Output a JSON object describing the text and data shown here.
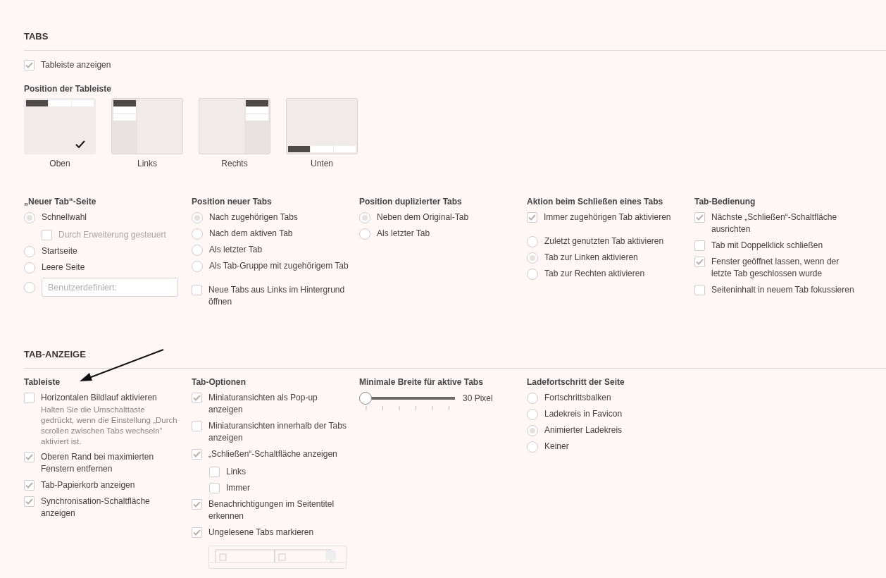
{
  "sections": [
    {
      "heading": "TABS",
      "show_tabbar": {
        "label": "Tableiste anzeigen",
        "checked": true
      },
      "positions_title": "Position der Tableiste",
      "positions": [
        {
          "kind": "top",
          "label": "Oben",
          "selected": true
        },
        {
          "kind": "left",
          "label": "Links",
          "selected": false
        },
        {
          "kind": "right",
          "label": "Rechts",
          "selected": false
        },
        {
          "kind": "bottom",
          "label": "Unten",
          "selected": false
        }
      ],
      "columns": [
        {
          "title": "„Neuer Tab“-Seite",
          "groups": [
            [
              {
                "kind": "radio",
                "label": "Schnellwahl",
                "selected": true,
                "children": [
                  {
                    "kind": "checkbox",
                    "label": "Durch Erweiterung gesteuert",
                    "checked": false,
                    "disabled": true
                  }
                ]
              },
              {
                "kind": "radio",
                "label": "Startseite",
                "selected": false
              },
              {
                "kind": "radio",
                "label": "Leere Seite",
                "selected": false
              },
              {
                "kind": "field",
                "placeholder": "Benutzerdefiniert:",
                "selected": false
              }
            ]
          ]
        },
        {
          "title": "Position neuer Tabs",
          "groups": [
            [
              {
                "kind": "radio",
                "label": "Nach zugehörigen Tabs",
                "selected": true
              },
              {
                "kind": "radio",
                "label": "Nach dem aktiven Tab",
                "selected": false
              },
              {
                "kind": "radio",
                "label": "Als letzter Tab",
                "selected": false
              },
              {
                "kind": "radio",
                "label": "Als Tab-Gruppe mit zugehörigem Tab",
                "selected": false
              }
            ],
            [
              {
                "kind": "checkbox",
                "label": "Neue Tabs aus Links im Hintergrund öffnen",
                "checked": false
              }
            ]
          ]
        },
        {
          "title": "Position duplizierter Tabs",
          "groups": [
            [
              {
                "kind": "radio",
                "label": "Neben dem Original-Tab",
                "selected": true
              },
              {
                "kind": "radio",
                "label": "Als letzter Tab",
                "selected": false
              }
            ]
          ]
        },
        {
          "title": "Aktion beim Schließen eines Tabs",
          "groups": [
            [
              {
                "kind": "checkbox",
                "label": "Immer zugehörigen Tab aktivieren",
                "checked": true
              }
            ],
            [
              {
                "kind": "radio",
                "label": "Zuletzt genutzten Tab aktivieren",
                "selected": false
              },
              {
                "kind": "radio",
                "label": "Tab zur Linken aktivieren",
                "selected": true
              },
              {
                "kind": "radio",
                "label": "Tab zur Rechten aktivieren",
                "selected": false
              }
            ]
          ]
        },
        {
          "title": "Tab-Bedienung",
          "groups": [
            [
              {
                "kind": "checkbox",
                "label": "Nächste „Schließen“-Schaltfläche ausrichten",
                "checked": true
              },
              {
                "kind": "checkbox",
                "label": "Tab mit Doppelklick schließen",
                "checked": false
              },
              {
                "kind": "checkbox",
                "label": "Fenster geöffnet lassen, wenn der letzte Tab geschlossen wurde",
                "checked": true
              },
              {
                "kind": "checkbox",
                "label": "Seiteninhalt in neuem Tab fokussieren",
                "checked": false
              }
            ]
          ]
        }
      ]
    },
    {
      "heading": "TAB-ANZEIGE",
      "columns": [
        {
          "title": "Tableiste",
          "groups": [
            [
              {
                "kind": "checkbox",
                "label": "Horizontalen Bildlauf aktivieren",
                "checked": false,
                "note": "Halten Sie die Umschalttaste gedrückt, wenn die Einstellung „Durch scrollen zwischen Tabs wechseln“ aktiviert ist."
              },
              {
                "kind": "checkbox",
                "label": "Oberen Rand bei maximierten Fenstern entfernen",
                "checked": true
              },
              {
                "kind": "checkbox",
                "label": "Tab-Papierkorb anzeigen",
                "checked": true
              },
              {
                "kind": "checkbox",
                "label": "Synchronisation-Schaltfläche anzeigen",
                "checked": true
              }
            ]
          ]
        },
        {
          "title": "Tab-Optionen",
          "groups": [
            [
              {
                "kind": "checkbox",
                "label": "Miniaturansichten als Pop-up anzeigen",
                "checked": true
              },
              {
                "kind": "checkbox",
                "label": "Miniaturansichten innerhalb der Tabs anzeigen",
                "checked": false
              },
              {
                "kind": "checkbox",
                "label": "„Schließen“-Schaltfläche anzeigen",
                "checked": true,
                "children": [
                  {
                    "kind": "checkbox",
                    "label": "Links",
                    "checked": false
                  },
                  {
                    "kind": "checkbox",
                    "label": "Immer",
                    "checked": false
                  }
                ]
              },
              {
                "kind": "checkbox",
                "label": "Benachrichtigungen im Seitentitel erkennen",
                "checked": true
              },
              {
                "kind": "checkbox",
                "label": "Ungelesene Tabs markieren",
                "checked": true,
                "preview": true
              }
            ]
          ]
        },
        {
          "title": "Minimale Breite für aktive Tabs",
          "groups": [
            [
              {
                "kind": "slider",
                "level": 0,
                "reading": "30 Pixel"
              }
            ]
          ]
        },
        {
          "title": "Ladefortschritt der Seite",
          "groups": [
            [
              {
                "kind": "radio",
                "label": "Fortschrittsbalken",
                "selected": false
              },
              {
                "kind": "radio",
                "label": "Ladekreis in Favicon",
                "selected": false
              },
              {
                "kind": "radio",
                "label": "Animierter Ladekreis",
                "selected": true
              },
              {
                "kind": "radio",
                "label": "Keiner",
                "selected": false
              }
            ]
          ]
        }
      ]
    }
  ]
}
